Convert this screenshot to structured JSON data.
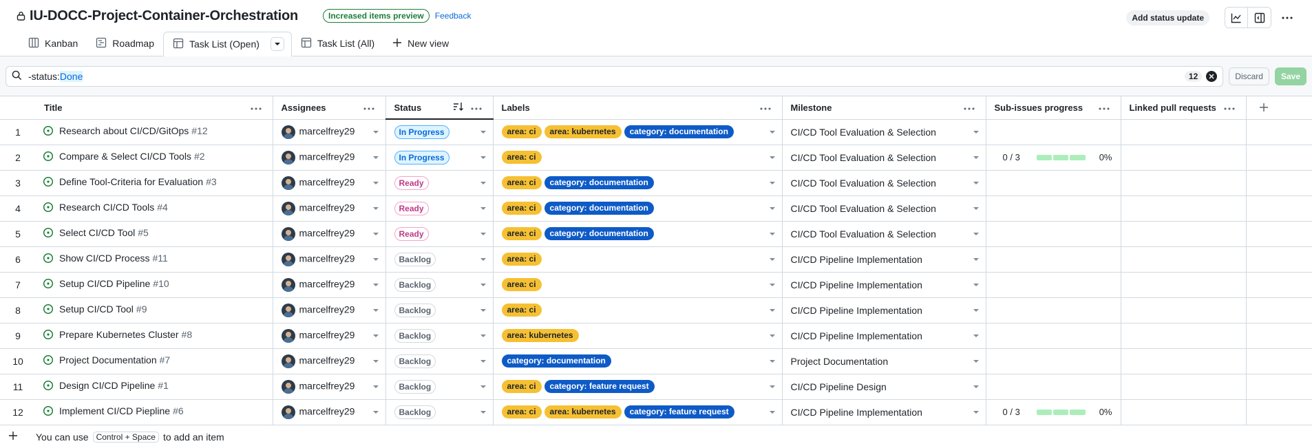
{
  "header": {
    "title": "IU-DOCC-Project-Container-Orchestration",
    "preview_badge": "Increased items preview",
    "feedback": "Feedback",
    "status_update": "Add status update"
  },
  "tabs": [
    {
      "label": "Kanban",
      "icon": "board-icon"
    },
    {
      "label": "Roadmap",
      "icon": "roadmap-icon"
    },
    {
      "label": "Task List (Open)",
      "icon": "table-icon"
    },
    {
      "label": "Task List (All)",
      "icon": "table-icon"
    },
    {
      "label": "New view",
      "icon": "plus-icon"
    }
  ],
  "filter": {
    "key": "-status:",
    "value": "Done",
    "count": "12",
    "discard": "Discard",
    "save": "Save"
  },
  "columns": [
    "Title",
    "Assignees",
    "Status",
    "Labels",
    "Milestone",
    "Sub-issues progress",
    "Linked pull requests"
  ],
  "rows": [
    {
      "n": "1",
      "title": "Research about CI/CD/GitOps",
      "num": "#12",
      "assignee": "marcelfrey29",
      "status": "In Progress",
      "status_class": "st-inprogress",
      "labels": [
        "area: ci",
        "area: kubernetes",
        "category: documentation"
      ],
      "milestone": "CI/CD Tool Evaluation & Selection",
      "progress": null
    },
    {
      "n": "2",
      "title": "Compare & Select CI/CD Tools",
      "num": "#2",
      "assignee": "marcelfrey29",
      "status": "In Progress",
      "status_class": "st-inprogress",
      "labels": [
        "area: ci"
      ],
      "milestone": "CI/CD Tool Evaluation & Selection",
      "progress": {
        "frac": "0 / 3",
        "pct": "0%"
      }
    },
    {
      "n": "3",
      "title": "Define Tool-Criteria for Evaluation",
      "num": "#3",
      "assignee": "marcelfrey29",
      "status": "Ready",
      "status_class": "st-ready",
      "labels": [
        "area: ci",
        "category: documentation"
      ],
      "milestone": "CI/CD Tool Evaluation & Selection",
      "progress": null
    },
    {
      "n": "4",
      "title": "Research CI/CD Tools",
      "num": "#4",
      "assignee": "marcelfrey29",
      "status": "Ready",
      "status_class": "st-ready",
      "labels": [
        "area: ci",
        "category: documentation"
      ],
      "milestone": "CI/CD Tool Evaluation & Selection",
      "progress": null
    },
    {
      "n": "5",
      "title": "Select CI/CD Tool",
      "num": "#5",
      "assignee": "marcelfrey29",
      "status": "Ready",
      "status_class": "st-ready",
      "labels": [
        "area: ci",
        "category: documentation"
      ],
      "milestone": "CI/CD Tool Evaluation & Selection",
      "progress": null
    },
    {
      "n": "6",
      "title": "Show CI/CD Process",
      "num": "#11",
      "assignee": "marcelfrey29",
      "status": "Backlog",
      "status_class": "st-backlog",
      "labels": [
        "area: ci"
      ],
      "milestone": "CI/CD Pipeline Implementation",
      "progress": null
    },
    {
      "n": "7",
      "title": "Setup CI/CD Pipeline",
      "num": "#10",
      "assignee": "marcelfrey29",
      "status": "Backlog",
      "status_class": "st-backlog",
      "labels": [
        "area: ci"
      ],
      "milestone": "CI/CD Pipeline Implementation",
      "progress": null
    },
    {
      "n": "8",
      "title": "Setup CI/CD Tool",
      "num": "#9",
      "assignee": "marcelfrey29",
      "status": "Backlog",
      "status_class": "st-backlog",
      "labels": [
        "area: ci"
      ],
      "milestone": "CI/CD Pipeline Implementation",
      "progress": null
    },
    {
      "n": "9",
      "title": "Prepare Kubernetes Cluster",
      "num": "#8",
      "assignee": "marcelfrey29",
      "status": "Backlog",
      "status_class": "st-backlog",
      "labels": [
        "area: kubernetes"
      ],
      "milestone": "CI/CD Pipeline Implementation",
      "progress": null
    },
    {
      "n": "10",
      "title": "Project Documentation",
      "num": "#7",
      "assignee": "marcelfrey29",
      "status": "Backlog",
      "status_class": "st-backlog",
      "labels": [
        "category: documentation"
      ],
      "milestone": "Project Documentation",
      "progress": null
    },
    {
      "n": "11",
      "title": "Design CI/CD Pipeline",
      "num": "#1",
      "assignee": "marcelfrey29",
      "status": "Backlog",
      "status_class": "st-backlog",
      "labels": [
        "area: ci",
        "category: feature request"
      ],
      "milestone": "CI/CD Pipeline Design",
      "progress": null
    },
    {
      "n": "12",
      "title": "Implement CI/CD Piepline",
      "num": "#6",
      "assignee": "marcelfrey29",
      "status": "Backlog",
      "status_class": "st-backlog",
      "labels": [
        "area: ci",
        "area: kubernetes",
        "category: feature request"
      ],
      "milestone": "CI/CD Pipeline Implementation",
      "progress": {
        "frac": "0 / 3",
        "pct": "0%"
      }
    }
  ],
  "add_row": {
    "prefix": "You can use",
    "kbd": "Control + Space",
    "suffix": "to add an item"
  },
  "colors": {
    "accent": "#0969da",
    "green": "#1a7f37",
    "label_yellow": "#f5c033",
    "label_blue": "#0e5bc7"
  }
}
